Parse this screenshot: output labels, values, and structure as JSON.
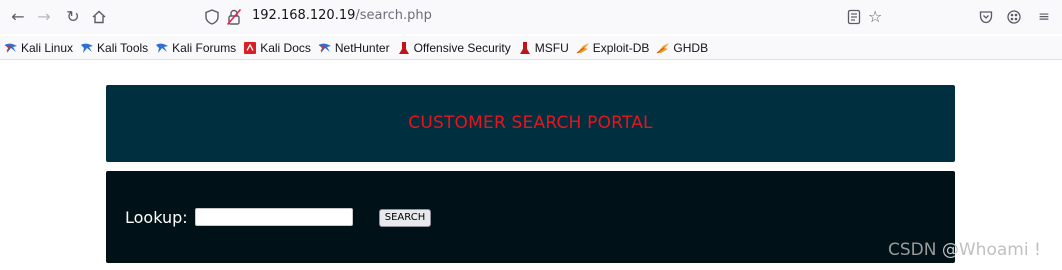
{
  "toolbar": {
    "url_host": "192.168.120.19",
    "url_path": "/search.php"
  },
  "bookmarks": [
    {
      "label": "Kali Linux",
      "icon": "kali-dragon-icon"
    },
    {
      "label": "Kali Tools",
      "icon": "kali-dragon-icon"
    },
    {
      "label": "Kali Forums",
      "icon": "kali-dragon-icon"
    },
    {
      "label": "Kali Docs",
      "icon": "kali-docs-icon"
    },
    {
      "label": "NetHunter",
      "icon": "kali-dragon-icon"
    },
    {
      "label": "Offensive Security",
      "icon": "offsec-icon"
    },
    {
      "label": "MSFU",
      "icon": "offsec-icon"
    },
    {
      "label": "Exploit-DB",
      "icon": "exploitdb-icon"
    },
    {
      "label": "GHDB",
      "icon": "exploitdb-icon"
    }
  ],
  "page": {
    "header_title": "CUSTOMER SEARCH PORTAL",
    "lookup_label": "Lookup:",
    "lookup_value": "",
    "search_button": "SEARCH"
  },
  "watermark": {
    "csdn": "CSDN",
    "handle": "@Whoami !"
  },
  "colors": {
    "header_bg": "#003040",
    "header_title": "#e8141c",
    "search_bg": "#001217"
  }
}
